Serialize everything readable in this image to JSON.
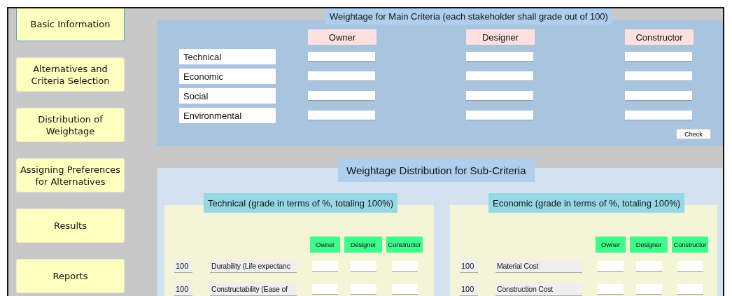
{
  "sidebar": {
    "items": [
      {
        "label": "Basic Information",
        "selected": true
      },
      {
        "label": "Alternatives and Criteria Selection",
        "selected": false
      },
      {
        "label": "Distribution of Weightage",
        "selected": false
      },
      {
        "label": "Assigning Preferences for Alternatives",
        "selected": false
      },
      {
        "label": "Results",
        "selected": false
      },
      {
        "label": "Reports",
        "selected": false
      }
    ]
  },
  "main_criteria": {
    "title": "Weightage for Main Criteria (each stakeholder shall grade out of 100)",
    "columns": [
      "Owner",
      "Designer",
      "Constructor"
    ],
    "rows": [
      {
        "label": "Technical"
      },
      {
        "label": "Economic"
      },
      {
        "label": "Social"
      },
      {
        "label": "Environmental"
      }
    ],
    "check_button": "Check"
  },
  "sub_criteria": {
    "title": "Weightage Distribution for Sub-Criteria",
    "groups": [
      {
        "title": "Technical (grade in terms of %, totaling 100%)",
        "columns": [
          "Owner",
          "Designer",
          "Constructor"
        ],
        "rows": [
          {
            "id": "100",
            "name": "Durability (Life expectanc"
          },
          {
            "id": "100",
            "name": "Constructability (Ease of"
          }
        ]
      },
      {
        "title": "Economic (grade in terms of %, totaling 100%)",
        "columns": [
          "Owner",
          "Designer",
          "Constructor"
        ],
        "rows": [
          {
            "id": "100",
            "name": "Material Cost"
          },
          {
            "id": "100",
            "name": "Construction Cost"
          }
        ]
      }
    ]
  }
}
